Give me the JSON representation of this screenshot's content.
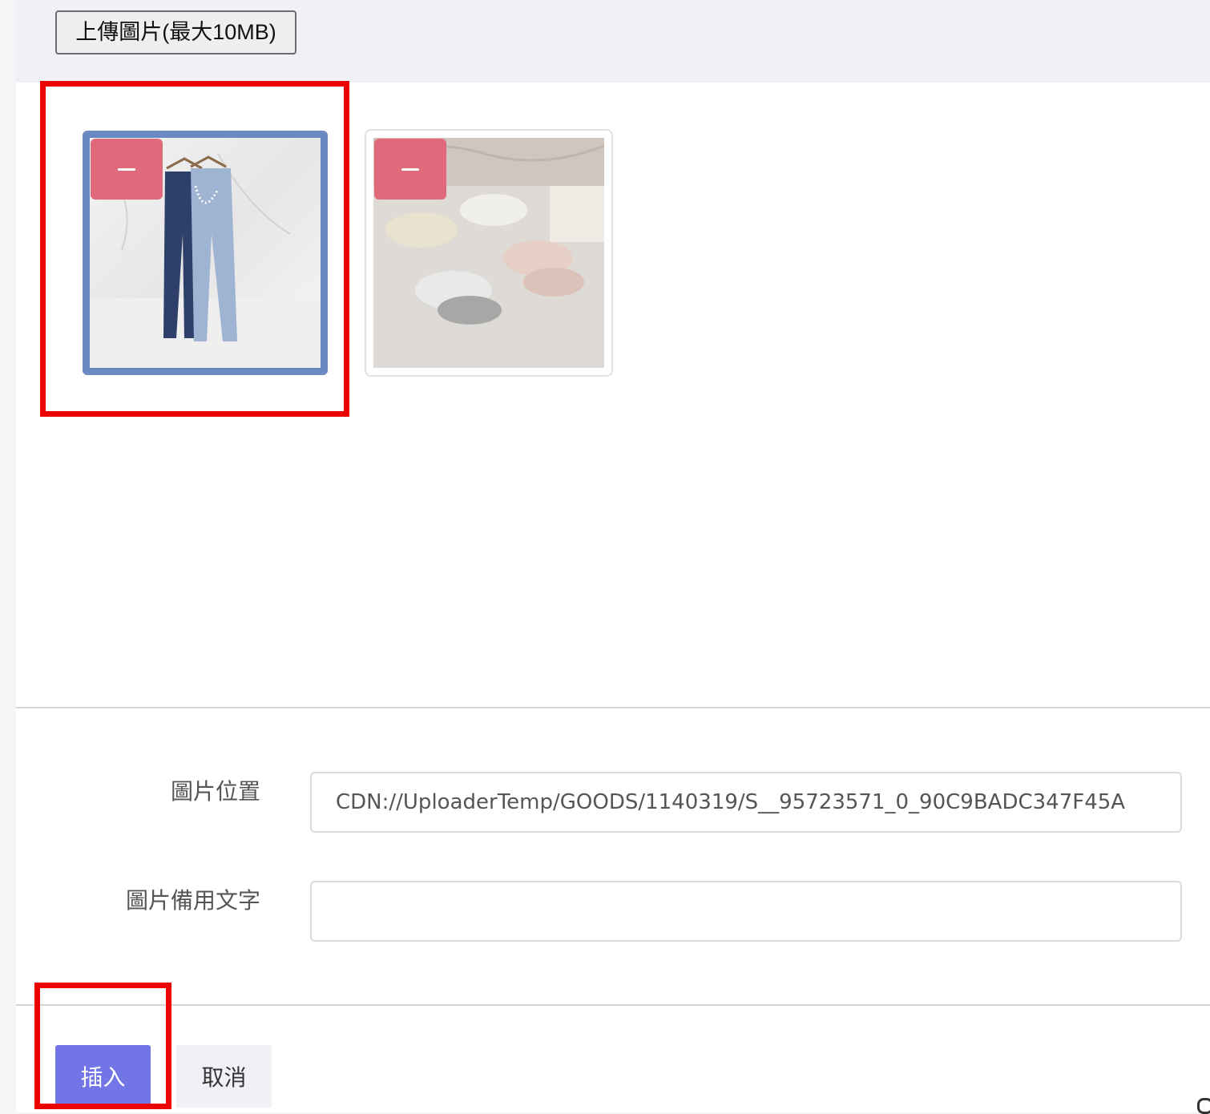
{
  "toolbar": {
    "upload_label": "上傳圖片(最大10MB)"
  },
  "gallery": {
    "images": [
      {
        "subject": "jeans",
        "selected": true,
        "remove_icon": "minus-icon"
      },
      {
        "subject": "sneakers",
        "selected": false,
        "remove_icon": "minus-icon"
      }
    ]
  },
  "form": {
    "location_label": "圖片位置",
    "location_value": "CDN://UploaderTemp/GOODS/1140319/S__95723571_0_90C9BADC347F45A",
    "alt_label": "圖片備用文字",
    "alt_value": ""
  },
  "actions": {
    "insert_label": "插入",
    "cancel_label": "取消"
  },
  "colors": {
    "selected_border": "#6a88c2",
    "remove_button": "#e06a7c",
    "insert_button": "#7275e6",
    "annotation_red": "#ec0000"
  }
}
